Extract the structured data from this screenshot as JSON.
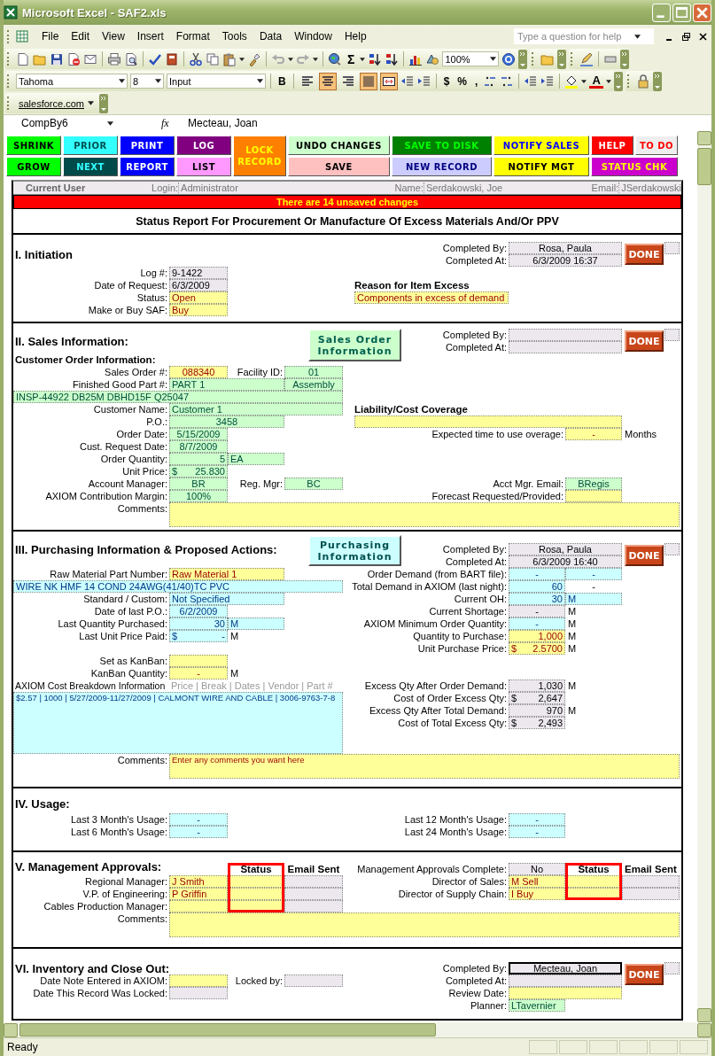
{
  "window": {
    "title": "Microsoft Excel - SAF2.xls"
  },
  "menu_bar": {
    "items": [
      "File",
      "Edit",
      "View",
      "Insert",
      "Format",
      "Tools",
      "Data",
      "Window",
      "Help"
    ],
    "help_box": {
      "placeholder": "Type a question for help"
    }
  },
  "standard_toolbar": {
    "sum_label": "Σ",
    "zoom": "100%"
  },
  "formatting_toolbar": {
    "font": "Tahoma",
    "size": "8",
    "style": "Input",
    "bold_label": "B",
    "toggles": [
      {
        "selected": false
      },
      {
        "selected": true
      },
      {
        "selected": false
      },
      {
        "selected": true
      },
      {
        "selected": true
      }
    ],
    "currency_label": "$",
    "percent_label": "%",
    "comma_label": ",",
    "font_color_label": "A"
  },
  "salesforce_toolbar": {
    "label": "salesforce.com"
  },
  "formula_bar": {
    "name_box": "CompBy6",
    "fx_label": "fx",
    "value": "Mecteau, Joan"
  },
  "macro_buttons": [
    {
      "label": "SHRINK",
      "kind": "normal",
      "color": "#00ff00"
    },
    {
      "label": "PRIOR",
      "kind": "normal",
      "color": "#33ffff"
    },
    {
      "label": "PRINT",
      "kind": "normal",
      "color": "#0000ff"
    },
    {
      "label": "LOG",
      "kind": "normal",
      "color": "#800080"
    },
    {
      "label": "LOCK RECORD",
      "kind": "tall",
      "color": "#ff8000"
    },
    {
      "label": "UNDO CHANGES",
      "kind": "normal",
      "color": "#ccffcc"
    },
    {
      "label": "SAVE TO DISK",
      "kind": "normal",
      "color": "#008000"
    },
    {
      "label": "NOTIFY SALES",
      "kind": "normal",
      "color": "#ffff00"
    },
    {
      "label": "HELP",
      "kind": "normal",
      "color": "#ff0000"
    },
    {
      "label": "TO DO",
      "kind": "normal",
      "color": "#eeeeee"
    },
    {
      "label": "GROW",
      "kind": "normal",
      "color": "#00ff00"
    },
    {
      "label": "NEXT",
      "kind": "normal",
      "color": "#004a4a"
    },
    {
      "label": "REPORT",
      "kind": "normal",
      "color": "#0000ff"
    },
    {
      "label": "LIST",
      "kind": "normal",
      "color": "#ff99ff"
    },
    {
      "label": "SAVE",
      "kind": "normal",
      "color": "#ffc0c0"
    },
    {
      "label": "NEW RECORD",
      "kind": "normal",
      "color": "#ccccff"
    },
    {
      "label": "NOTIFY MGT",
      "kind": "normal",
      "color": "#ffff00"
    },
    {
      "label": "STATUS CHK",
      "kind": "wide",
      "color": "#cc00cc"
    }
  ],
  "user_bar": {
    "title": "Current User",
    "login_label": "Login:",
    "login": "Administrator",
    "name_label": "Name:",
    "name": "Serdakowski, Joe",
    "email_label": "Email:",
    "email": "JSerdakowski"
  },
  "banner": "There are 14 unsaved changes",
  "report_title": "Status Report For Procurement Or Manufacture Of Excess Materials And/Or PPV",
  "sections": [
    {
      "items": [
        {
          "kind": "heading",
          "text": "I. Initiation"
        },
        {
          "kind": "label",
          "text": "Completed By:"
        },
        {
          "kind": "readonly",
          "text": "Rosa, Paula"
        },
        {
          "kind": "done",
          "text": "DONE"
        },
        {
          "kind": "readonly"
        },
        {
          "kind": "label",
          "text": "Completed At:"
        },
        {
          "kind": "readonly",
          "text": "6/3/2009 16:37"
        },
        {
          "kind": "label",
          "text": "Log #:"
        },
        {
          "kind": "readonly",
          "text": "9-1422"
        },
        {
          "kind": "label",
          "text": "Date of Request:"
        },
        {
          "kind": "readonly",
          "text": "6/3/2009"
        },
        {
          "kind": "subheading",
          "text": "Reason for Item Excess"
        },
        {
          "kind": "label",
          "text": "Status:"
        },
        {
          "kind": "input",
          "text": "Open"
        },
        {
          "kind": "input",
          "text": "Components in excess of demand"
        },
        {
          "kind": "label",
          "text": "Make or Buy SAF:"
        },
        {
          "kind": "input",
          "text": "Buy"
        }
      ]
    },
    {
      "items": [
        {
          "kind": "heading",
          "text": "II. Sales Information:"
        },
        {
          "kind": "button",
          "text": "Sales Order Information"
        },
        {
          "kind": "label",
          "text": "Completed By:"
        },
        {
          "kind": "readonly"
        },
        {
          "kind": "done",
          "text": "DONE"
        },
        {
          "kind": "readonly"
        },
        {
          "kind": "label",
          "text": "Completed At:"
        },
        {
          "kind": "readonly"
        },
        {
          "kind": "subheading",
          "text": "Customer Order Information:"
        },
        {
          "kind": "label",
          "text": "Sales Order #:"
        },
        {
          "kind": "input",
          "text": "088340"
        },
        {
          "kind": "label",
          "text": "Facility ID:"
        },
        {
          "kind": "sales",
          "text": "01"
        },
        {
          "kind": "label",
          "text": "Finished Good Part #:"
        },
        {
          "kind": "sales",
          "text": "PART 1"
        },
        {
          "kind": "sales",
          "text": "Assembly"
        },
        {
          "kind": "sales",
          "text": "INSP-44922 DB25M DBHD15F Q25047"
        },
        {
          "kind": "label",
          "text": "Customer Name:"
        },
        {
          "kind": "sales",
          "text": "Customer 1"
        },
        {
          "kind": "subheading",
          "text": "Liability/Cost Coverage"
        },
        {
          "kind": "label",
          "text": "P.O.:"
        },
        {
          "kind": "sales",
          "text": "3458"
        },
        {
          "kind": "input"
        },
        {
          "kind": "label",
          "text": "Order Date:"
        },
        {
          "kind": "sales",
          "text": "5/15/2009"
        },
        {
          "kind": "label",
          "text": "Expected time to use overage:"
        },
        {
          "kind": "input",
          "text": "-"
        },
        {
          "kind": "unit",
          "text": "Months"
        },
        {
          "kind": "label",
          "text": "Cust. Request Date:"
        },
        {
          "kind": "sales",
          "text": "8/7/2009"
        },
        {
          "kind": "label",
          "text": "Order Quantity:"
        },
        {
          "kind": "sales",
          "text": "5"
        },
        {
          "kind": "sales",
          "text": "EA"
        },
        {
          "kind": "label",
          "text": "Unit Price:"
        },
        {
          "kind": "sales",
          "prefix": "$",
          "text": "25.830"
        },
        {
          "kind": "label",
          "text": "Account Manager:"
        },
        {
          "kind": "sales",
          "text": "BR"
        },
        {
          "kind": "label",
          "text": "Reg. Mgr:"
        },
        {
          "kind": "sales",
          "text": "BC"
        },
        {
          "kind": "label",
          "text": "Acct Mgr. Email:"
        },
        {
          "kind": "sales",
          "text": "BRegis"
        },
        {
          "kind": "label",
          "text": "AXIOM Contribution Margin:"
        },
        {
          "kind": "sales",
          "text": "100%"
        },
        {
          "kind": "label",
          "text": "Forecast Requested/Provided:"
        },
        {
          "kind": "input"
        },
        {
          "kind": "label",
          "text": "Comments:"
        },
        {
          "kind": "input"
        }
      ]
    },
    {
      "items": [
        {
          "kind": "heading",
          "text": "III. Purchasing Information & Proposed Actions:"
        },
        {
          "kind": "button",
          "text": "Purchasing Information"
        },
        {
          "kind": "label",
          "text": "Completed By:"
        },
        {
          "kind": "readonly",
          "text": "Rosa, Paula"
        },
        {
          "kind": "done",
          "text": "DONE"
        },
        {
          "kind": "readonly"
        },
        {
          "kind": "label",
          "text": "Completed At:"
        },
        {
          "kind": "readonly",
          "text": "6/3/2009 16:40"
        },
        {
          "kind": "label",
          "text": "Raw Material Part Number:"
        },
        {
          "kind": "input",
          "text": "Raw Material 1"
        },
        {
          "kind": "label",
          "text": "Order Demand (from BART file):"
        },
        {
          "kind": "purch",
          "text": "-"
        },
        {
          "kind": "purch",
          "text": "-"
        },
        {
          "kind": "purch",
          "text": "WIRE NK HMF 14 COND 24AWG(41/40)TC PVC"
        },
        {
          "kind": "label",
          "text": "Total Demand in AXIOM (last night):"
        },
        {
          "kind": "purch",
          "text": "60"
        },
        {
          "kind": "unit",
          "text": "-"
        },
        {
          "kind": "label",
          "text": "Standard / Custom:"
        },
        {
          "kind": "purch",
          "text": "Not Specified"
        },
        {
          "kind": "label",
          "text": "Current OH:"
        },
        {
          "kind": "purch",
          "text": "30"
        },
        {
          "kind": "purch",
          "text": "M"
        },
        {
          "kind": "label",
          "text": "Date of last P.O.:"
        },
        {
          "kind": "purch",
          "text": "6/2/2009"
        },
        {
          "kind": "label",
          "text": "Current Shortage:"
        },
        {
          "kind": "readonly",
          "text": "-"
        },
        {
          "kind": "unit",
          "text": "M"
        },
        {
          "kind": "label",
          "text": "Last Quantity Purchased:"
        },
        {
          "kind": "purch",
          "text": "30"
        },
        {
          "kind": "purch",
          "text": "M"
        },
        {
          "kind": "label",
          "text": "AXIOM Minimum Order Quantity:"
        },
        {
          "kind": "purch",
          "text": "-"
        },
        {
          "kind": "unit",
          "text": "M"
        },
        {
          "kind": "label",
          "text": "Last Unit Price Paid:"
        },
        {
          "kind": "purch",
          "prefix": "$",
          "text": "-"
        },
        {
          "kind": "unit",
          "text": "M"
        },
        {
          "kind": "label",
          "text": "Quantity to Purchase:"
        },
        {
          "kind": "input",
          "text": "1,000"
        },
        {
          "kind": "unit",
          "text": "M"
        },
        {
          "kind": "label",
          "text": "Unit Purchase Price:"
        },
        {
          "kind": "input",
          "prefix": "$",
          "text": "2.5700"
        },
        {
          "kind": "unit",
          "text": "M"
        },
        {
          "kind": "label",
          "text": "Set as KanBan:"
        },
        {
          "kind": "input"
        },
        {
          "kind": "label",
          "text": "KanBan Quantity:"
        },
        {
          "kind": "input",
          "text": "-"
        },
        {
          "kind": "unit",
          "text": "M"
        },
        {
          "kind": "label",
          "text": "AXIOM Cost Breakdown Information"
        },
        {
          "kind": "note",
          "text": "Price | Break | Dates | Vendor | Part #"
        },
        {
          "kind": "label",
          "text": "Excess Qty After Order Demand:"
        },
        {
          "kind": "readonly",
          "text": "1,030"
        },
        {
          "kind": "unit",
          "text": "M"
        },
        {
          "kind": "purch",
          "text": "$2.57 | 1000 | 5/27/2009-11/27/2009 | CALMONT WIRE AND CABLE | 3006-9763-7-8"
        },
        {
          "kind": "label",
          "text": "Cost of Order Excess Qty:"
        },
        {
          "kind": "readonly",
          "prefix": "$",
          "text": "2,647"
        },
        {
          "kind": "label",
          "text": "Excess Qty After Total Demand:"
        },
        {
          "kind": "readonly",
          "text": "970"
        },
        {
          "kind": "unit",
          "text": "M"
        },
        {
          "kind": "label",
          "text": "Cost of Total Excess Qty:"
        },
        {
          "kind": "readonly",
          "prefix": "$",
          "text": "2,493"
        },
        {
          "kind": "label",
          "text": "Comments:"
        },
        {
          "kind": "input",
          "text": "Enter any comments you want here"
        }
      ]
    },
    {
      "items": [
        {
          "kind": "heading",
          "text": "IV. Usage:"
        },
        {
          "kind": "label",
          "text": "Last 3 Month's Usage:"
        },
        {
          "kind": "purch",
          "text": "-"
        },
        {
          "kind": "label",
          "text": "Last 12 Month's Usage:"
        },
        {
          "kind": "purch",
          "text": "-"
        },
        {
          "kind": "label",
          "text": "Last 6 Month's Usage:"
        },
        {
          "kind": "purch",
          "text": "-"
        },
        {
          "kind": "label",
          "text": "Last 24 Month's Usage:"
        },
        {
          "kind": "purch",
          "text": "-"
        }
      ]
    },
    {
      "items": [
        {
          "kind": "heading",
          "text": "V. Management Approvals:"
        },
        {
          "kind": "colhead",
          "text": "Status"
        },
        {
          "kind": "colhead",
          "text": "Email Sent"
        },
        {
          "kind": "label",
          "text": "Management Approvals Complete:"
        },
        {
          "kind": "readonly",
          "text": "No"
        },
        {
          "kind": "colhead",
          "text": "Status"
        },
        {
          "kind": "colhead",
          "text": "Email Sent"
        },
        {
          "kind": "label",
          "text": "Regional Manager:"
        },
        {
          "kind": "input",
          "text": "J Smith"
        },
        {
          "kind": "input"
        },
        {
          "kind": "readonly"
        },
        {
          "kind": "label",
          "text": "Director of Sales:"
        },
        {
          "kind": "input",
          "text": "M Sell"
        },
        {
          "kind": "input"
        },
        {
          "kind": "readonly"
        },
        {
          "kind": "label",
          "text": "V.P. of Engineering:"
        },
        {
          "kind": "input",
          "text": "P Griffin"
        },
        {
          "kind": "input"
        },
        {
          "kind": "readonly"
        },
        {
          "kind": "label",
          "text": "Director of Supply Chain:"
        },
        {
          "kind": "input",
          "text": "I Buy"
        },
        {
          "kind": "input"
        },
        {
          "kind": "readonly"
        },
        {
          "kind": "label",
          "text": "Cables Production Manager:"
        },
        {
          "kind": "input"
        },
        {
          "kind": "input"
        },
        {
          "kind": "readonly"
        },
        {
          "kind": "label",
          "text": "Comments:"
        },
        {
          "kind": "input"
        }
      ]
    },
    {
      "items": [
        {
          "kind": "heading",
          "text": "VI. Inventory and Close Out:"
        },
        {
          "kind": "label",
          "text": "Completed By:"
        },
        {
          "kind": "readonly",
          "text": "Mecteau, Joan",
          "selected": true
        },
        {
          "kind": "done",
          "text": "DONE"
        },
        {
          "kind": "readonly"
        },
        {
          "kind": "label",
          "text": "Date Note Entered in AXIOM:"
        },
        {
          "kind": "input"
        },
        {
          "kind": "label",
          "text": "Locked by:"
        },
        {
          "kind": "readonly"
        },
        {
          "kind": "label",
          "text": "Completed At:"
        },
        {
          "kind": "readonly"
        },
        {
          "kind": "label",
          "text": "Date This Record Was Locked:"
        },
        {
          "kind": "readonly"
        },
        {
          "kind": "label",
          "text": "Review Date:"
        },
        {
          "kind": "input"
        },
        {
          "kind": "label",
          "text": "Planner:"
        },
        {
          "kind": "sales",
          "text": "LTavernier"
        }
      ]
    }
  ],
  "status_bar": {
    "text": "Ready"
  }
}
